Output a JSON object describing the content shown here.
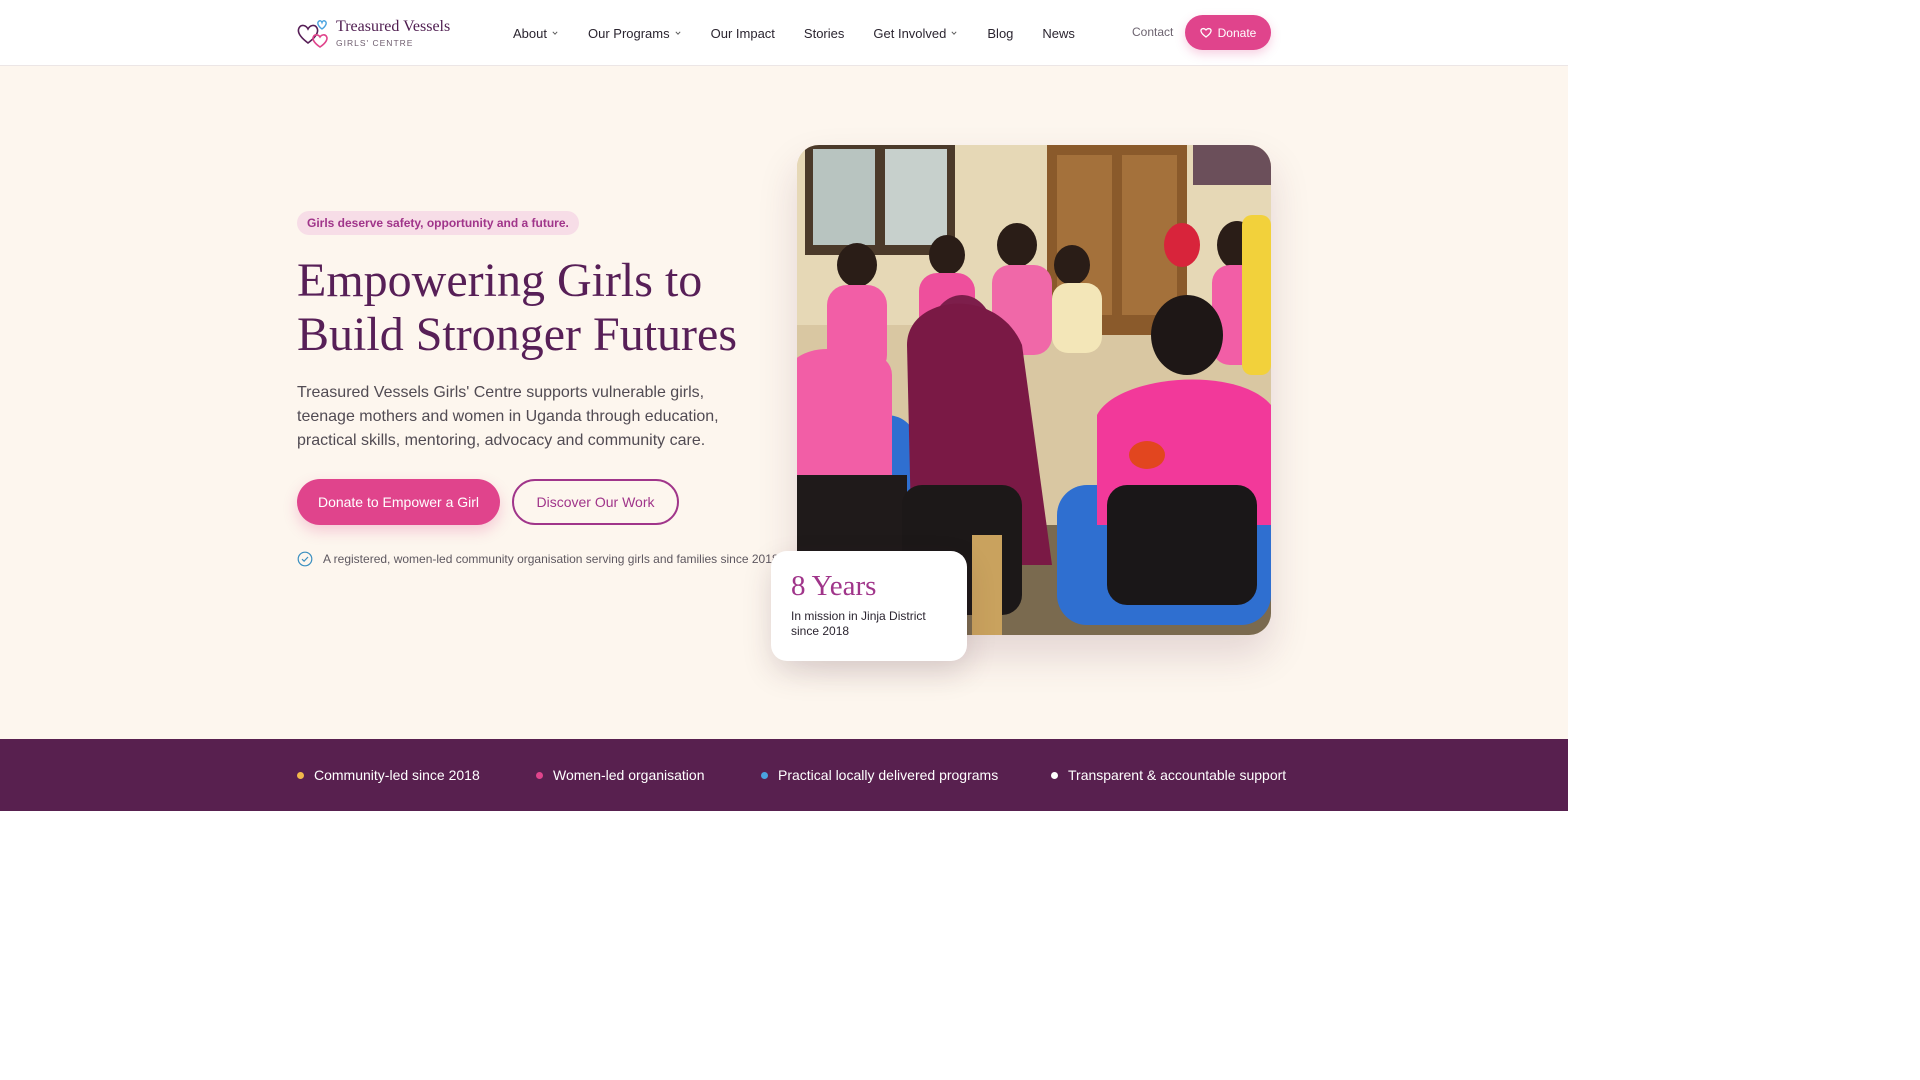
{
  "header": {
    "logo_name": "Treasured Vessels",
    "logo_sub": "GIRLS' CENTRE",
    "nav": [
      {
        "label": "About",
        "has_dropdown": true
      },
      {
        "label": "Our Programs",
        "has_dropdown": true
      },
      {
        "label": "Our Impact",
        "has_dropdown": false
      },
      {
        "label": "Stories",
        "has_dropdown": false
      },
      {
        "label": "Get Involved",
        "has_dropdown": true
      },
      {
        "label": "Blog",
        "has_dropdown": false
      },
      {
        "label": "News",
        "has_dropdown": false
      }
    ],
    "contact_label": "Contact",
    "donate_label": "Donate"
  },
  "hero": {
    "tagline": "Girls deserve safety, opportunity and a future.",
    "headline": "Empowering Girls to Build Stronger Futures",
    "intro": "Treasured Vessels Girls' Centre supports vulnerable girls, teenage mothers and women in Uganda through education, practical skills, mentoring, advocacy and community care.",
    "primary_button": "Donate to Empower a Girl",
    "secondary_button": "Discover Our Work",
    "registration_note": "A registered, women-led community organisation serving girls and families since 2018.",
    "stat_card": {
      "value": "8 Years",
      "label": "In mission in Jinja District since 2018"
    }
  },
  "band": {
    "items": [
      {
        "label": "Community-led since 2018",
        "dot_color": "#f2b84b"
      },
      {
        "label": "Women-led organisation",
        "dot_color": "#e0448c"
      },
      {
        "label": "Practical locally delivered programs",
        "dot_color": "#4aa3df"
      },
      {
        "label": "Transparent & accountable support",
        "dot_color": "#ffffff"
      }
    ]
  },
  "colors": {
    "brand_pink": "#e0448c",
    "brand_purple": "#571f57",
    "accent_purple": "#a0358a",
    "hero_bg": "#fdf6ee",
    "band_bg": "#58204f"
  }
}
